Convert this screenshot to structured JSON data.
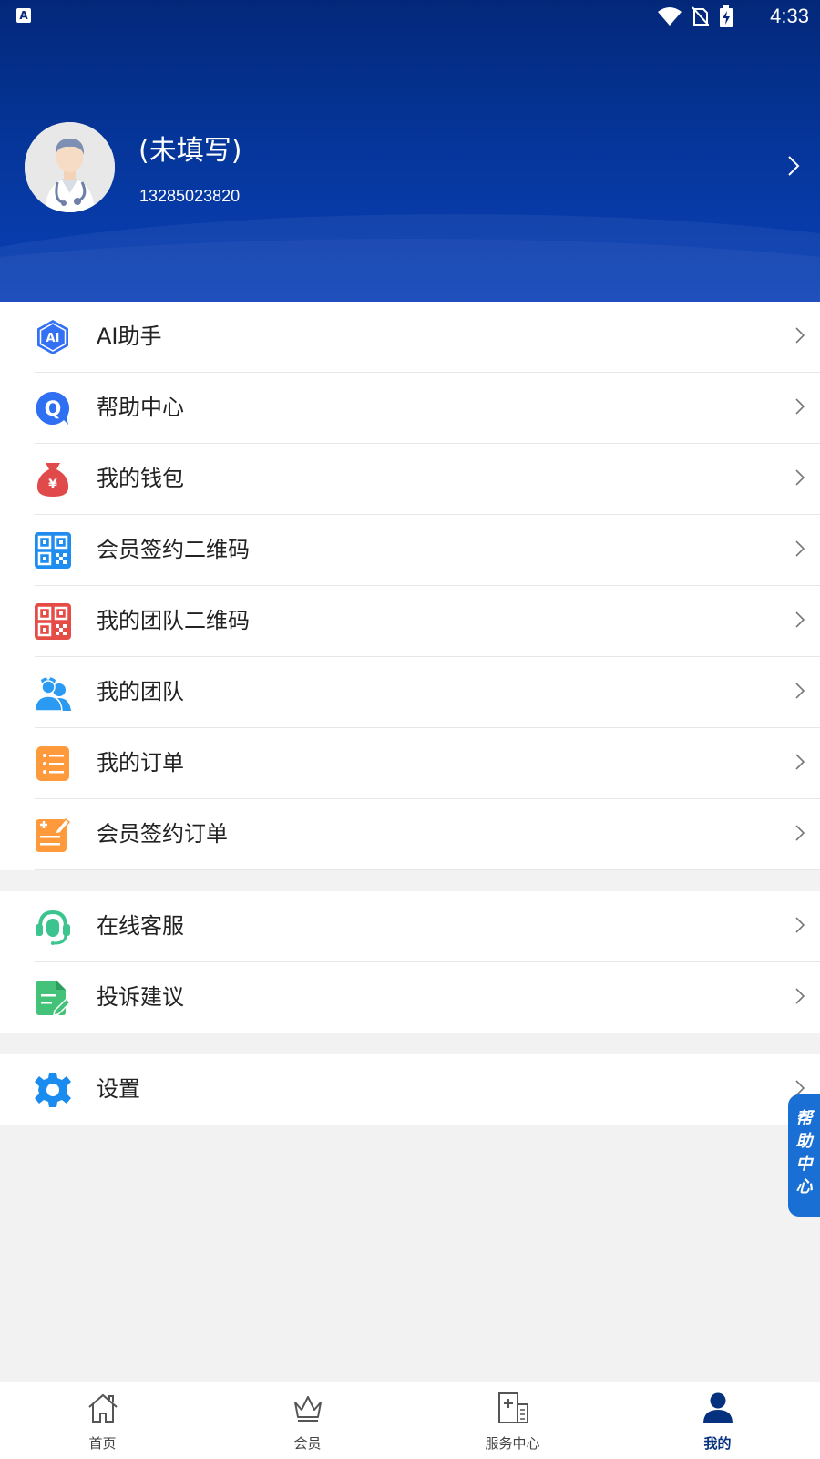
{
  "status_bar": {
    "time": "4:33",
    "app_icon": "A"
  },
  "profile": {
    "name": "(未填写)",
    "phone": "13285023820"
  },
  "menu_group1": [
    {
      "label": "AI助手",
      "icon": "ai-icon"
    },
    {
      "label": "帮助中心",
      "icon": "help-q-icon"
    },
    {
      "label": "我的钱包",
      "icon": "wallet-icon"
    },
    {
      "label": "会员签约二维码",
      "icon": "qr-code-blue-icon"
    },
    {
      "label": "我的团队二维码",
      "icon": "qr-code-red-icon"
    },
    {
      "label": "我的团队",
      "icon": "team-icon"
    },
    {
      "label": "我的订单",
      "icon": "order-list-icon"
    },
    {
      "label": "会员签约订单",
      "icon": "sign-order-icon"
    }
  ],
  "menu_group2": [
    {
      "label": "在线客服",
      "icon": "headset-icon"
    },
    {
      "label": "投诉建议",
      "icon": "complaint-icon"
    }
  ],
  "menu_group3": [
    {
      "label": "设置",
      "icon": "gear-icon"
    }
  ],
  "float_help": {
    "label": "帮助中心"
  },
  "bottom_nav": [
    {
      "label": "首页",
      "icon": "home-icon"
    },
    {
      "label": "会员",
      "icon": "crown-icon"
    },
    {
      "label": "服务中心",
      "icon": "service-center-icon"
    },
    {
      "label": "我的",
      "icon": "person-icon",
      "active": true
    }
  ],
  "colors": {
    "header": "#053598",
    "nav_active": "#06317f",
    "float_help": "#1a6fd4"
  }
}
